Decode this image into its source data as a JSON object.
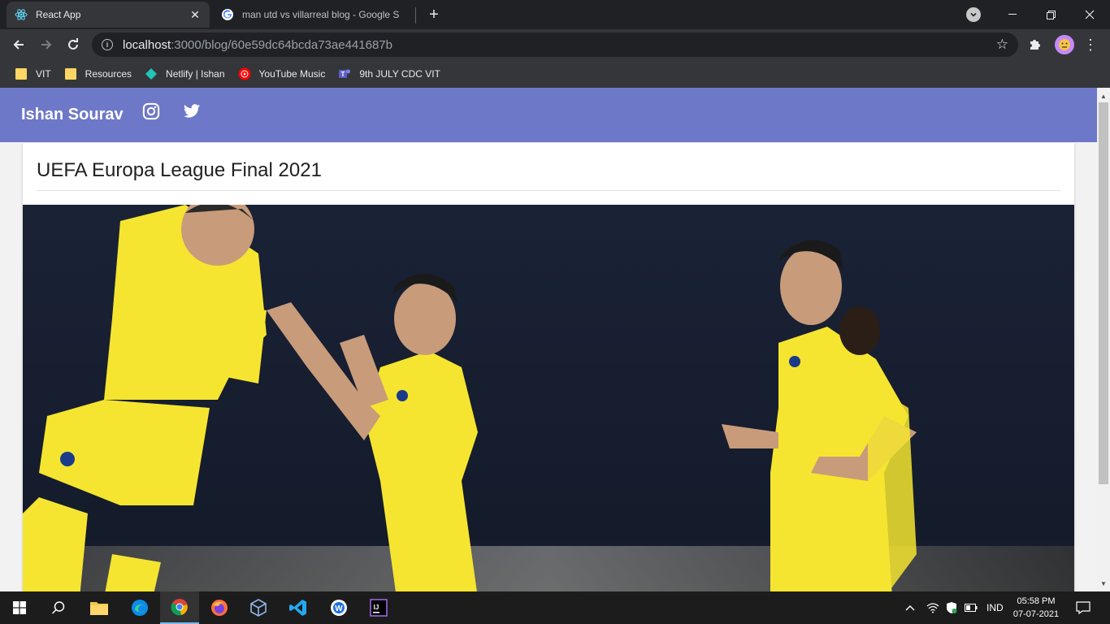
{
  "browser": {
    "tabs": [
      {
        "title": "React App",
        "favicon": "react-icon",
        "active": true
      },
      {
        "title": "man utd vs villarreal blog - Google S",
        "favicon": "google-icon",
        "active": false
      }
    ],
    "address": {
      "host": "localhost",
      "path": ":3000/blog/60e59dc64bcda73ae441687b"
    },
    "bookmarks": [
      {
        "label": "VIT",
        "icon": "folder-icon"
      },
      {
        "label": "Resources",
        "icon": "folder-icon"
      },
      {
        "label": "Netlify | Ishan",
        "icon": "netlify-icon"
      },
      {
        "label": "YouTube Music",
        "icon": "youtube-music-icon"
      },
      {
        "label": "9th JULY CDC VIT",
        "icon": "teams-icon"
      }
    ]
  },
  "app": {
    "brand": "Ishan Sourav",
    "social": [
      "instagram-icon",
      "twitter-icon"
    ],
    "accent": "#6e78c9"
  },
  "post": {
    "title": "UEFA Europa League Final 2021",
    "image_alt": "Villarreal players celebrating in yellow kits"
  },
  "taskbar": {
    "language": "IND",
    "time": "05:58 PM",
    "date": "07-07-2021"
  }
}
